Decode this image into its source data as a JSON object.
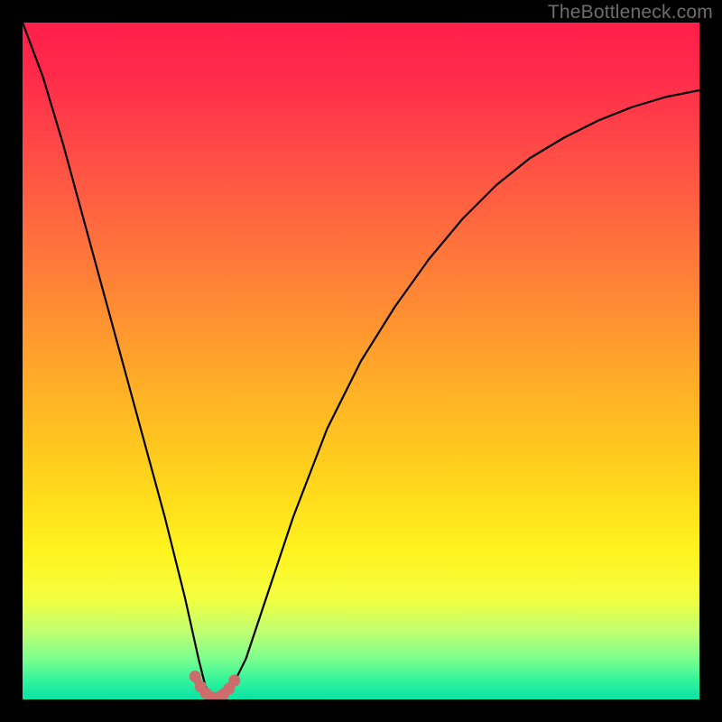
{
  "watermark": "TheBottleneck.com",
  "colors": {
    "frame": "#000000",
    "curve": "#000000",
    "marker_stroke": "#c96a6a",
    "marker_fill": "#cc6d6b",
    "gradient_top": "#ff1f4a",
    "gradient_bottom": "#10e2a3"
  },
  "chart_data": {
    "type": "line",
    "title": "",
    "xlabel": "",
    "ylabel": "",
    "ylim": [
      0,
      100
    ],
    "xlim": [
      0,
      100
    ],
    "description": "Bottleneck-style V curve on a vertical rainbow gradient. x is an abstract parameter (0–100 across plot width), y is bottleneck percentage (0 at bottom, 100 at top). Minimum is near x≈28 where y≈0.",
    "series": [
      {
        "name": "curve",
        "x": [
          0,
          3,
          6,
          9,
          12,
          15,
          18,
          21,
          24,
          26,
          27,
          28,
          29,
          30,
          31,
          33,
          36,
          40,
          45,
          50,
          55,
          60,
          65,
          70,
          75,
          80,
          85,
          90,
          95,
          100
        ],
        "values": [
          100,
          92,
          82,
          71,
          60,
          49,
          38,
          27,
          15,
          6,
          2,
          0,
          0,
          1,
          2,
          6,
          15,
          27,
          40,
          50,
          58,
          65,
          71,
          76,
          80,
          83,
          85.5,
          87.5,
          89,
          90
        ]
      }
    ],
    "markers": {
      "name": "optimal-range",
      "x": [
        25.5,
        26.3,
        27.1,
        28.0,
        28.9,
        29.7,
        30.5,
        31.3
      ],
      "values": [
        3.4,
        1.9,
        0.9,
        0.3,
        0.3,
        0.8,
        1.6,
        2.8
      ]
    }
  }
}
